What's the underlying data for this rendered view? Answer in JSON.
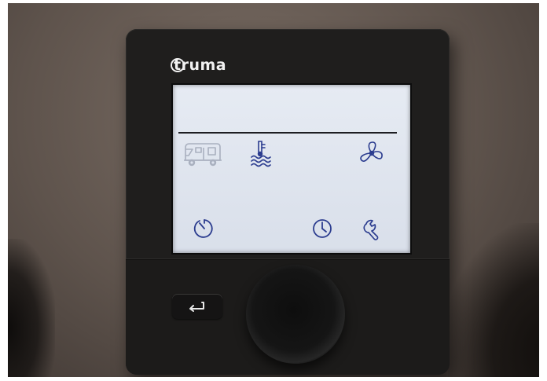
{
  "brand": {
    "logo_text": "truma"
  },
  "colors": {
    "screen_bg": "#dde3ee",
    "icon_active": "#2b3c8f",
    "icon_inactive": "#a9b0bf",
    "housing": "#1f1e1d"
  },
  "screen": {
    "top_row": [
      {
        "id": "vehicle-mode",
        "icon": "motorhome-icon",
        "state": "inactive"
      },
      {
        "id": "water-heating",
        "icon": "water-temperature-icon",
        "state": "active"
      },
      {
        "id": "ventilation",
        "icon": "fan-icon",
        "state": "active"
      }
    ],
    "bottom_row": [
      {
        "id": "timer",
        "icon": "timer-icon"
      },
      {
        "id": "clock",
        "icon": "clock-icon"
      },
      {
        "id": "service",
        "icon": "wrench-icon"
      }
    ]
  },
  "controls": {
    "back_icon": "back-arrow-icon",
    "knob": "rotary-knob"
  }
}
